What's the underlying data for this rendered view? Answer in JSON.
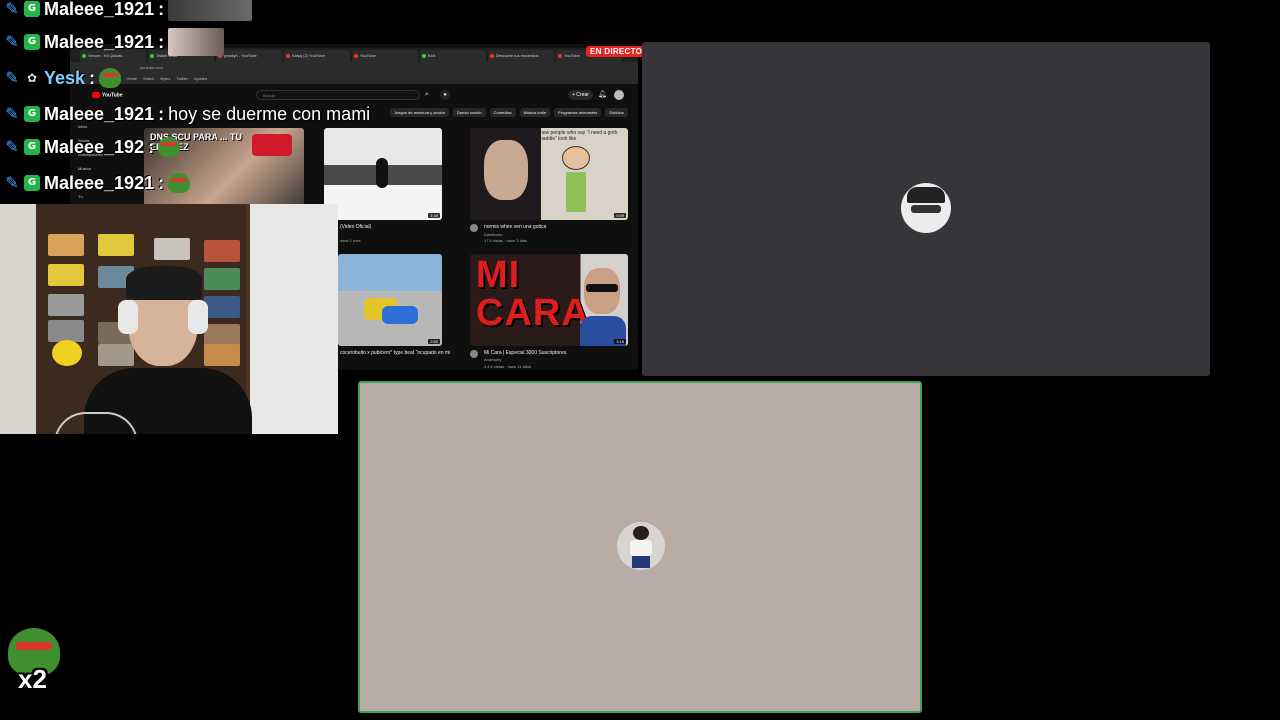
{
  "chat": [
    {
      "user": "Maleee_1921",
      "suffix": ":",
      "user_color": "#ffffff",
      "message": "",
      "has_image": true
    },
    {
      "user": "Maleee_1921",
      "suffix": ":",
      "user_color": "#ffffff",
      "message": "",
      "has_image": true
    },
    {
      "user": "Yesk",
      "suffix": ":",
      "user_color": "#7fd0ff",
      "message": "",
      "has_emote": true
    },
    {
      "user": "Maleee_1921",
      "suffix": ":",
      "user_color": "#ffffff",
      "message": "hoy se duerme con mami"
    },
    {
      "user": "Maleee_192",
      "suffix": ":",
      "user_color": "#ffffff",
      "message": "",
      "has_emote": true
    },
    {
      "user": "Maleee_1921",
      "suffix": ":",
      "user_color": "#ffffff",
      "message": "",
      "has_emote": true
    }
  ],
  "browser": {
    "live_badge": "EN DIRECTO",
    "tabs": [
      "Venom - Kit Quizás",
      "Twitch Chat",
      "yesdlyh - YouTube",
      "Kasaj (2) YouTube",
      "YouTube",
      "Kick",
      "Descubre tus recuerdos",
      "YouTube"
    ],
    "address": "youtube.com",
    "bookmarks": [
      "Gmail",
      "Home",
      "Watch",
      "Bytes",
      "Twitter",
      "Ajustes"
    ],
    "yt": {
      "logo": "YouTube",
      "search_placeholder": "Buscar",
      "create_label": "+ Crear",
      "chips": [
        "Juegos de aventura y acción",
        "Dando sonido",
        "Comedias",
        "Música Indie",
        "Programas relevantes",
        "Subidos"
      ],
      "sidebar": [
        "Inicio",
        "Shorts",
        "Suscripciones",
        "Música",
        "Historial",
        "Tú"
      ]
    },
    "videos": [
      {
        "title": "(Video Oficial)",
        "meta": "hace 1 mes",
        "duration": "1:48"
      },
      {
        "title": "normis when ven una gotica",
        "meta": "17 k vistas · hace 3 días",
        "channel": "Darkfrontn",
        "duration": "0:59"
      },
      {
        "title": "cocerobuito x pubicero* type beat \"ocupado en mi",
        "meta": "",
        "duration": "2:50"
      },
      {
        "title": "Mi Cara | Especial 3000 Suscriptores.",
        "meta": "3,4 k vistas · hace 11 años",
        "channel": "Ananscity",
        "duration": "3:15"
      }
    ],
    "thumb_texts": {
      "top_left": "DNS SCU PARA ... TU ERA VEZ",
      "gothic": "how people who say \"i need a goth baddie\" look like",
      "micara": "MI CARA"
    }
  },
  "emote_counter": {
    "label": "x2"
  },
  "colors": {
    "tile_top": "#37353a",
    "tile_bottom": "#b9aca7",
    "speaking_ring": "#3ba55d",
    "live_red": "#e52424",
    "pencil_blue": "#3aa0ff",
    "badge_green": "#25b34b"
  }
}
